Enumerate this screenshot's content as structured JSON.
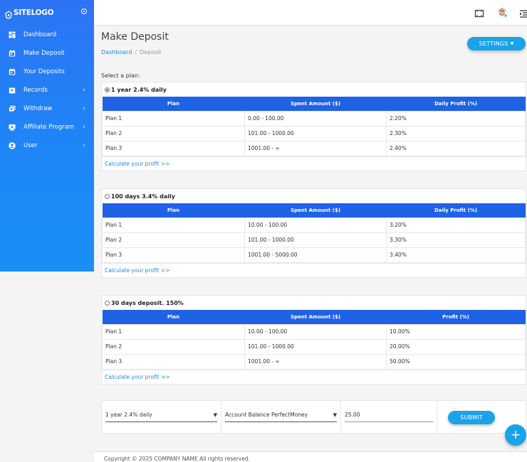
{
  "logo": {
    "text": "SITELOGO"
  },
  "sidebar": {
    "items": [
      {
        "label": "Dashboard",
        "icon": "dashboard-icon",
        "has_chevron": false
      },
      {
        "label": "Make Deposit",
        "icon": "calendar-icon",
        "has_chevron": false
      },
      {
        "label": "Your Deposits",
        "icon": "calendar-icon",
        "has_chevron": false
      },
      {
        "label": "Records",
        "icon": "record-icon",
        "has_chevron": true
      },
      {
        "label": "Withdraw",
        "icon": "withdraw-icon",
        "has_chevron": true
      },
      {
        "label": "Affiliate Program",
        "icon": "affiliate-icon",
        "has_chevron": true
      },
      {
        "label": "User",
        "icon": "user-icon",
        "has_chevron": true
      }
    ]
  },
  "header": {
    "title": "Make Deposit",
    "breadcrumb": {
      "home": "Dashboard",
      "separator": "/",
      "current": "Deposit"
    },
    "settings_label": "SETTINGS"
  },
  "select_label": "Select a plan:",
  "plans": [
    {
      "name": "1 year 2.4% daily",
      "selected": true,
      "columns": [
        "Plan",
        "Spent Amount ($)",
        "Daily Profit (%)"
      ],
      "rows": [
        [
          "Plan 1",
          "0.00 - 100.00",
          "2.20%"
        ],
        [
          "Plan 2",
          "101.00 - 1000.00",
          "2.30%"
        ],
        [
          "Plan 3",
          "1001.00 - ∞",
          "2.40%"
        ]
      ],
      "calc_label": "Calculate your profit >>"
    },
    {
      "name": "100 days 3.4% daily",
      "selected": false,
      "columns": [
        "Plan",
        "Spent Amount ($)",
        "Daily Profit (%)"
      ],
      "rows": [
        [
          "Plan 1",
          "10.00 - 100.00",
          "3.20%"
        ],
        [
          "Plan 2",
          "101.00 - 1000.00",
          "3.30%"
        ],
        [
          "Plan 3",
          "1001.00 - 5000.00",
          "3.40%"
        ]
      ],
      "calc_label": "Calculate your profit >>"
    },
    {
      "name": "30 days deposit. 150%",
      "selected": false,
      "columns": [
        "Plan",
        "Spent Amount ($)",
        "Profit (%)"
      ],
      "rows": [
        [
          "Plan 1",
          "10.00 - 100.00",
          "10.00%"
        ],
        [
          "Plan 2",
          "101.00 - 1000.00",
          "20.00%"
        ],
        [
          "Plan 3",
          "1001.00 - ∞",
          "50.00%"
        ]
      ],
      "calc_label": "Calculate your profit >>"
    }
  ],
  "form": {
    "plan_select": "1 year 2.4% daily",
    "account_select": "Account Balance PerfectMoney",
    "amount": "25.00",
    "submit_label": "SUBMIT"
  },
  "fab_label": "+",
  "footer": {
    "text": "Copyright © 2025 COMPANY NAME All rights reserved."
  },
  "colors": {
    "sidebar": "#2a78f6",
    "table_header": "#1e62e6",
    "accent": "#1aa3e8",
    "link": "#1e88e5"
  }
}
